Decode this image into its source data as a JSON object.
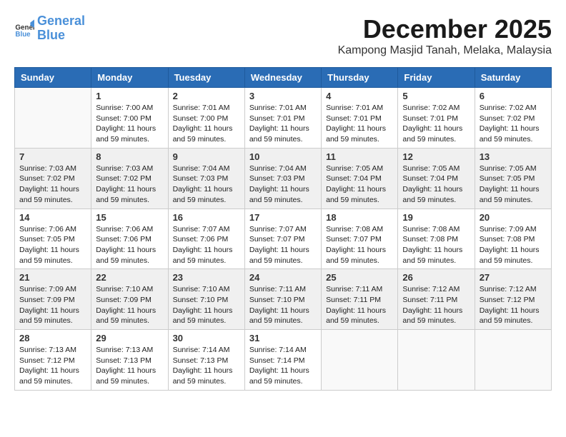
{
  "logo": {
    "line1": "General",
    "line2": "Blue"
  },
  "header": {
    "month_year": "December 2025",
    "location": "Kampong Masjid Tanah, Melaka, Malaysia"
  },
  "weekdays": [
    "Sunday",
    "Monday",
    "Tuesday",
    "Wednesday",
    "Thursday",
    "Friday",
    "Saturday"
  ],
  "rows": [
    [
      {
        "day": "",
        "empty": true
      },
      {
        "day": "1",
        "sunrise": "Sunrise: 7:00 AM",
        "sunset": "Sunset: 7:00 PM",
        "daylight": "Daylight: 11 hours and 59 minutes."
      },
      {
        "day": "2",
        "sunrise": "Sunrise: 7:01 AM",
        "sunset": "Sunset: 7:00 PM",
        "daylight": "Daylight: 11 hours and 59 minutes."
      },
      {
        "day": "3",
        "sunrise": "Sunrise: 7:01 AM",
        "sunset": "Sunset: 7:01 PM",
        "daylight": "Daylight: 11 hours and 59 minutes."
      },
      {
        "day": "4",
        "sunrise": "Sunrise: 7:01 AM",
        "sunset": "Sunset: 7:01 PM",
        "daylight": "Daylight: 11 hours and 59 minutes."
      },
      {
        "day": "5",
        "sunrise": "Sunrise: 7:02 AM",
        "sunset": "Sunset: 7:01 PM",
        "daylight": "Daylight: 11 hours and 59 minutes."
      },
      {
        "day": "6",
        "sunrise": "Sunrise: 7:02 AM",
        "sunset": "Sunset: 7:02 PM",
        "daylight": "Daylight: 11 hours and 59 minutes."
      }
    ],
    [
      {
        "day": "7",
        "sunrise": "Sunrise: 7:03 AM",
        "sunset": "Sunset: 7:02 PM",
        "daylight": "Daylight: 11 hours and 59 minutes."
      },
      {
        "day": "8",
        "sunrise": "Sunrise: 7:03 AM",
        "sunset": "Sunset: 7:02 PM",
        "daylight": "Daylight: 11 hours and 59 minutes."
      },
      {
        "day": "9",
        "sunrise": "Sunrise: 7:04 AM",
        "sunset": "Sunset: 7:03 PM",
        "daylight": "Daylight: 11 hours and 59 minutes."
      },
      {
        "day": "10",
        "sunrise": "Sunrise: 7:04 AM",
        "sunset": "Sunset: 7:03 PM",
        "daylight": "Daylight: 11 hours and 59 minutes."
      },
      {
        "day": "11",
        "sunrise": "Sunrise: 7:05 AM",
        "sunset": "Sunset: 7:04 PM",
        "daylight": "Daylight: 11 hours and 59 minutes."
      },
      {
        "day": "12",
        "sunrise": "Sunrise: 7:05 AM",
        "sunset": "Sunset: 7:04 PM",
        "daylight": "Daylight: 11 hours and 59 minutes."
      },
      {
        "day": "13",
        "sunrise": "Sunrise: 7:05 AM",
        "sunset": "Sunset: 7:05 PM",
        "daylight": "Daylight: 11 hours and 59 minutes."
      }
    ],
    [
      {
        "day": "14",
        "sunrise": "Sunrise: 7:06 AM",
        "sunset": "Sunset: 7:05 PM",
        "daylight": "Daylight: 11 hours and 59 minutes."
      },
      {
        "day": "15",
        "sunrise": "Sunrise: 7:06 AM",
        "sunset": "Sunset: 7:06 PM",
        "daylight": "Daylight: 11 hours and 59 minutes."
      },
      {
        "day": "16",
        "sunrise": "Sunrise: 7:07 AM",
        "sunset": "Sunset: 7:06 PM",
        "daylight": "Daylight: 11 hours and 59 minutes."
      },
      {
        "day": "17",
        "sunrise": "Sunrise: 7:07 AM",
        "sunset": "Sunset: 7:07 PM",
        "daylight": "Daylight: 11 hours and 59 minutes."
      },
      {
        "day": "18",
        "sunrise": "Sunrise: 7:08 AM",
        "sunset": "Sunset: 7:07 PM",
        "daylight": "Daylight: 11 hours and 59 minutes."
      },
      {
        "day": "19",
        "sunrise": "Sunrise: 7:08 AM",
        "sunset": "Sunset: 7:08 PM",
        "daylight": "Daylight: 11 hours and 59 minutes."
      },
      {
        "day": "20",
        "sunrise": "Sunrise: 7:09 AM",
        "sunset": "Sunset: 7:08 PM",
        "daylight": "Daylight: 11 hours and 59 minutes."
      }
    ],
    [
      {
        "day": "21",
        "sunrise": "Sunrise: 7:09 AM",
        "sunset": "Sunset: 7:09 PM",
        "daylight": "Daylight: 11 hours and 59 minutes."
      },
      {
        "day": "22",
        "sunrise": "Sunrise: 7:10 AM",
        "sunset": "Sunset: 7:09 PM",
        "daylight": "Daylight: 11 hours and 59 minutes."
      },
      {
        "day": "23",
        "sunrise": "Sunrise: 7:10 AM",
        "sunset": "Sunset: 7:10 PM",
        "daylight": "Daylight: 11 hours and 59 minutes."
      },
      {
        "day": "24",
        "sunrise": "Sunrise: 7:11 AM",
        "sunset": "Sunset: 7:10 PM",
        "daylight": "Daylight: 11 hours and 59 minutes."
      },
      {
        "day": "25",
        "sunrise": "Sunrise: 7:11 AM",
        "sunset": "Sunset: 7:11 PM",
        "daylight": "Daylight: 11 hours and 59 minutes."
      },
      {
        "day": "26",
        "sunrise": "Sunrise: 7:12 AM",
        "sunset": "Sunset: 7:11 PM",
        "daylight": "Daylight: 11 hours and 59 minutes."
      },
      {
        "day": "27",
        "sunrise": "Sunrise: 7:12 AM",
        "sunset": "Sunset: 7:12 PM",
        "daylight": "Daylight: 11 hours and 59 minutes."
      }
    ],
    [
      {
        "day": "28",
        "sunrise": "Sunrise: 7:13 AM",
        "sunset": "Sunset: 7:12 PM",
        "daylight": "Daylight: 11 hours and 59 minutes."
      },
      {
        "day": "29",
        "sunrise": "Sunrise: 7:13 AM",
        "sunset": "Sunset: 7:13 PM",
        "daylight": "Daylight: 11 hours and 59 minutes."
      },
      {
        "day": "30",
        "sunrise": "Sunrise: 7:14 AM",
        "sunset": "Sunset: 7:13 PM",
        "daylight": "Daylight: 11 hours and 59 minutes."
      },
      {
        "day": "31",
        "sunrise": "Sunrise: 7:14 AM",
        "sunset": "Sunset: 7:14 PM",
        "daylight": "Daylight: 11 hours and 59 minutes."
      },
      {
        "day": "",
        "empty": true
      },
      {
        "day": "",
        "empty": true
      },
      {
        "day": "",
        "empty": true
      }
    ]
  ]
}
